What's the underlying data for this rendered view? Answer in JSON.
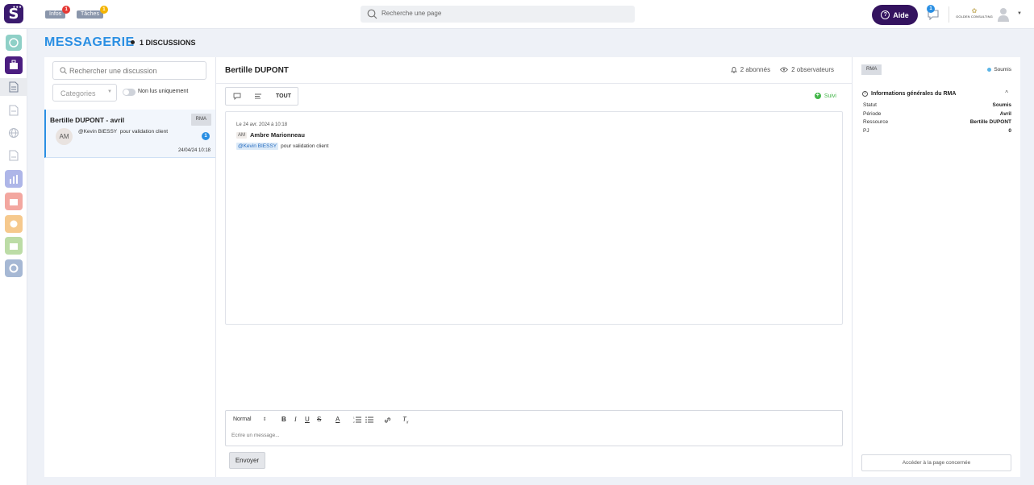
{
  "topbar": {
    "logo_letter": "S",
    "infos_label": "Infos",
    "infos_badge": "1",
    "infos_badge_color": "#e53935",
    "taches_label": "Tâches",
    "taches_badge": "1",
    "taches_badge_color": "#f4b400",
    "search_placeholder": "Recherche une page",
    "aide_label": "Aide",
    "chat_badge": "1",
    "company_name": "GOLDEN CONSULTING"
  },
  "rail": {
    "items": [
      {
        "icon": "dashboard-icon",
        "color": "#8fd0c7"
      },
      {
        "icon": "briefcase-icon",
        "color": "#4b1d80"
      },
      {
        "icon": "document-icon",
        "color": "#9aa3b4",
        "selected": true
      },
      {
        "icon": "file-list-icon",
        "color": "#b7bdc9"
      },
      {
        "icon": "globe-icon",
        "color": "#b7bdc9"
      },
      {
        "icon": "file-icon",
        "color": "#b7bdc9"
      },
      {
        "icon": "chart-icon",
        "color": "#aeb6e8"
      },
      {
        "icon": "suitcase-icon",
        "color": "#f3a7a0"
      },
      {
        "icon": "coin-icon",
        "color": "#f6c98d"
      },
      {
        "icon": "bag-icon",
        "color": "#bcdca6"
      },
      {
        "icon": "settings-icon",
        "color": "#a6b8d4"
      }
    ]
  },
  "header": {
    "title": "MESSAGERIE",
    "count_label": "1 DISCUSSIONS"
  },
  "left_panel": {
    "search_placeholder": "Rechercher une discussion",
    "category_placeholder": "Categories",
    "unread_toggle_label": "Non lus uniquement",
    "discussions": [
      {
        "title": "Bertille DUPONT - avril",
        "tag": "RMA",
        "avatar": "AM",
        "mention": "@Kevin BIESSY",
        "message": "pour validation client",
        "unread": "1",
        "date": "24/04/24 10:18"
      }
    ]
  },
  "middle_panel": {
    "title": "Bertille DUPONT",
    "subscribers": "2 abonnés",
    "observers": "2 observateurs",
    "filter_all": "TOUT",
    "suivi_label": "Suivi",
    "message": {
      "date": "Le 24 avr. 2024 à 10:18",
      "author_initials": "AM",
      "author": "Ambre Marionneau",
      "mention": "@Kevin BIESSY",
      "text": "pour validation client"
    },
    "editor": {
      "format": "Normal",
      "placeholder": "Ecrire un message...",
      "send_label": "Envoyer"
    }
  },
  "right_panel": {
    "tag": "RMA",
    "status": "Soumis",
    "section_title": "Informations générales du RMA",
    "rows": [
      {
        "label": "Statut",
        "value": "Soumis"
      },
      {
        "label": "Période",
        "value": "Avril"
      },
      {
        "label": "Ressource",
        "value": "Bertille DUPONT"
      },
      {
        "label": "PJ",
        "value": "0"
      }
    ],
    "link_label": "Accéder à la page concernée"
  }
}
